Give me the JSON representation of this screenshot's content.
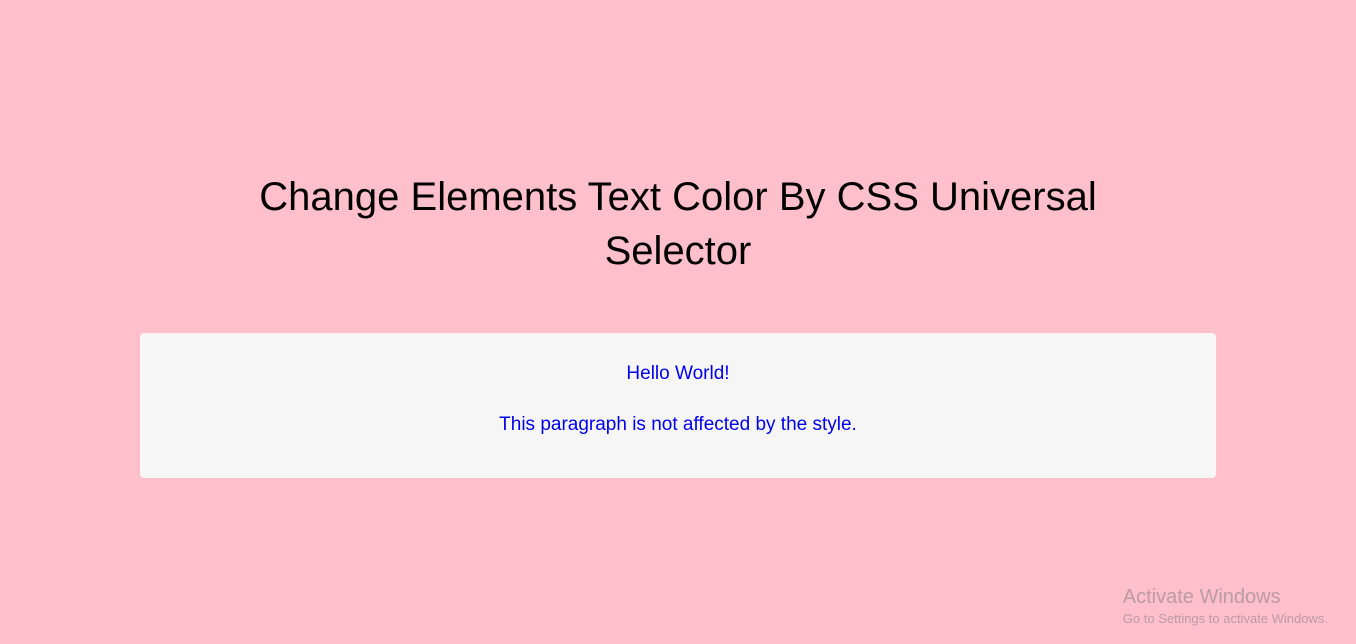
{
  "heading": "Change Elements Text Color By CSS Universal Selector",
  "content": {
    "line1": "Hello World!",
    "line2": "This paragraph is not affected by the style."
  },
  "watermark": {
    "title": "Activate Windows",
    "subtitle": "Go to Settings to activate Windows."
  }
}
